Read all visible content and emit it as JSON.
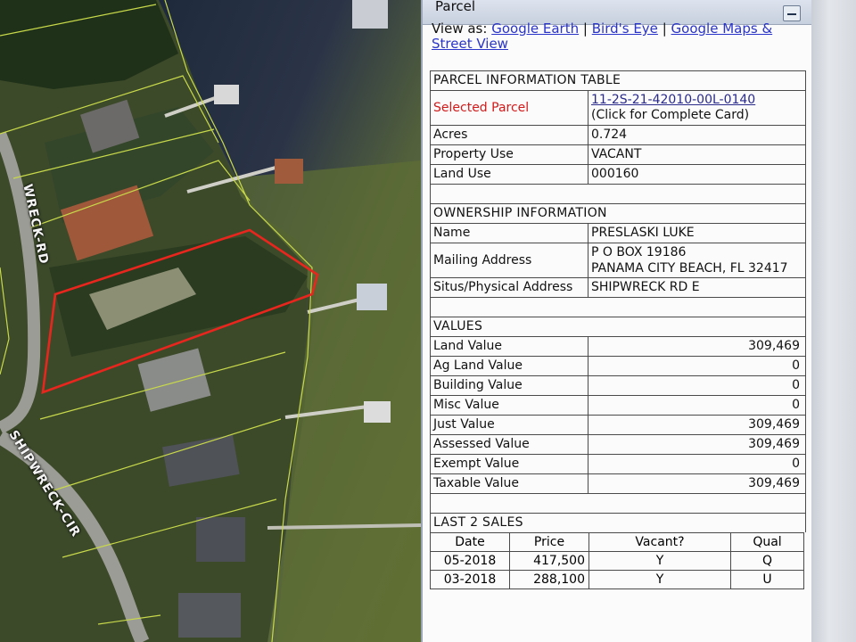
{
  "map": {
    "road_labels": [
      "WRECK-RD",
      "SHIPWRECK-CIR"
    ]
  },
  "panel": {
    "title": "Parcel",
    "view_as_label": "View as:",
    "links": [
      "Google Earth",
      "Bird's Eye",
      "Google Maps & Street View"
    ],
    "separator": "|"
  },
  "parcel_info": {
    "heading": "PARCEL INFORMATION TABLE",
    "selected_parcel_label": "Selected Parcel",
    "parcel_id": "11-2S-21-42010-00L-0140",
    "card_link": "(Click for Complete Card)",
    "rows": [
      {
        "label": "Acres",
        "value": "0.724"
      },
      {
        "label": "Property Use",
        "value": "VACANT"
      },
      {
        "label": "Land Use",
        "value": "000160"
      }
    ]
  },
  "ownership": {
    "heading": "OWNERSHIP INFORMATION",
    "name_label": "Name",
    "name": "PRESLASKI LUKE",
    "mailing_label": "Mailing Address",
    "mailing_line1": "P O BOX 19186",
    "mailing_line2": "PANAMA CITY BEACH, FL 32417",
    "situs_label": "Situs/Physical Address",
    "situs": "SHIPWRECK RD E"
  },
  "values": {
    "heading": "VALUES",
    "rows": [
      {
        "label": "Land Value",
        "value": "309,469"
      },
      {
        "label": "Ag Land Value",
        "value": "0"
      },
      {
        "label": "Building Value",
        "value": "0"
      },
      {
        "label": "Misc Value",
        "value": "0"
      },
      {
        "label": "Just Value",
        "value": "309,469"
      },
      {
        "label": "Assessed Value",
        "value": "309,469"
      },
      {
        "label": "Exempt Value",
        "value": "0"
      },
      {
        "label": "Taxable Value",
        "value": "309,469"
      }
    ]
  },
  "sales": {
    "heading": "LAST 2 SALES",
    "columns": [
      "Date",
      "Price",
      "Vacant?",
      "Qual"
    ],
    "rows": [
      {
        "date": "05-2018",
        "price": "417,500",
        "vacant": "Y",
        "qual": "Q"
      },
      {
        "date": "03-2018",
        "price": "288,100",
        "vacant": "Y",
        "qual": "U"
      }
    ]
  },
  "colors": {
    "selected_parcel_outline": "#e8261e",
    "parcel_lines": "#c8d94a",
    "link": "#2a34c8",
    "selected_label": "#d21a1a"
  }
}
